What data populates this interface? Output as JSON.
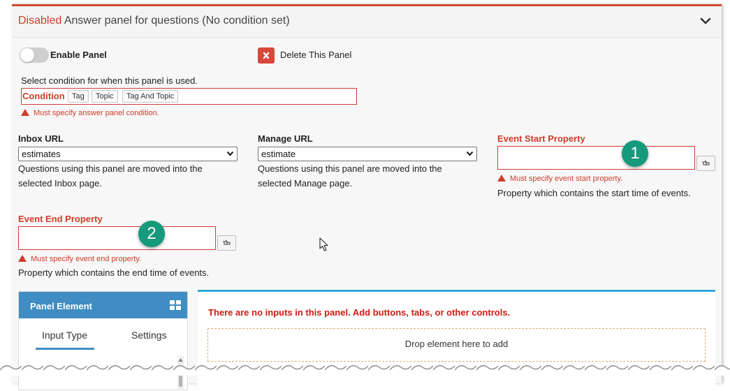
{
  "header": {
    "state": "Disabled",
    "title": "Answer panel for questions (No condition set)",
    "collapse_icon": "chevron-down-icon"
  },
  "enable_panel": {
    "label": "Enable Panel",
    "enabled": false
  },
  "delete_panel": {
    "label": "Delete This Panel",
    "icon": "close-icon"
  },
  "condition": {
    "intro": "Select condition for when this panel is used.",
    "label": "Condition",
    "options": [
      "Tag",
      "Topic",
      "Tag And Topic"
    ],
    "error": "Must specify answer panel condition."
  },
  "inbox_url": {
    "label": "Inbox URL",
    "value": "estimates",
    "help_line1": "Questions using this panel are moved into the",
    "help_line2": "selected Inbox page."
  },
  "manage_url": {
    "label": "Manage URL",
    "value": "estimate",
    "help_line1": "Questions using this panel are moved into the",
    "help_line2": "selected Manage page."
  },
  "event_start": {
    "label": "Event Start Property",
    "value": "",
    "error": "Must specify event start property.",
    "help": "Property which contains the start time of events.",
    "badge": "1"
  },
  "event_end": {
    "label": "Event End Property",
    "value": "",
    "error": "Must specify event end property.",
    "help": "Property which contains the end time of events.",
    "badge": "2"
  },
  "panel_element": {
    "title": "Panel Element",
    "tabs": [
      "Input Type",
      "Settings"
    ],
    "active_tab": "Input Type"
  },
  "content": {
    "empty_message": "There are no inputs in this panel. Add buttons, tabs, or other controls.",
    "drop_hint": "Drop element here to add"
  },
  "colors": {
    "accent_red": "#d03c28",
    "panel_blue": "#3f8dc2",
    "badge_green": "#159a7b",
    "content_top": "#34a9d8"
  }
}
